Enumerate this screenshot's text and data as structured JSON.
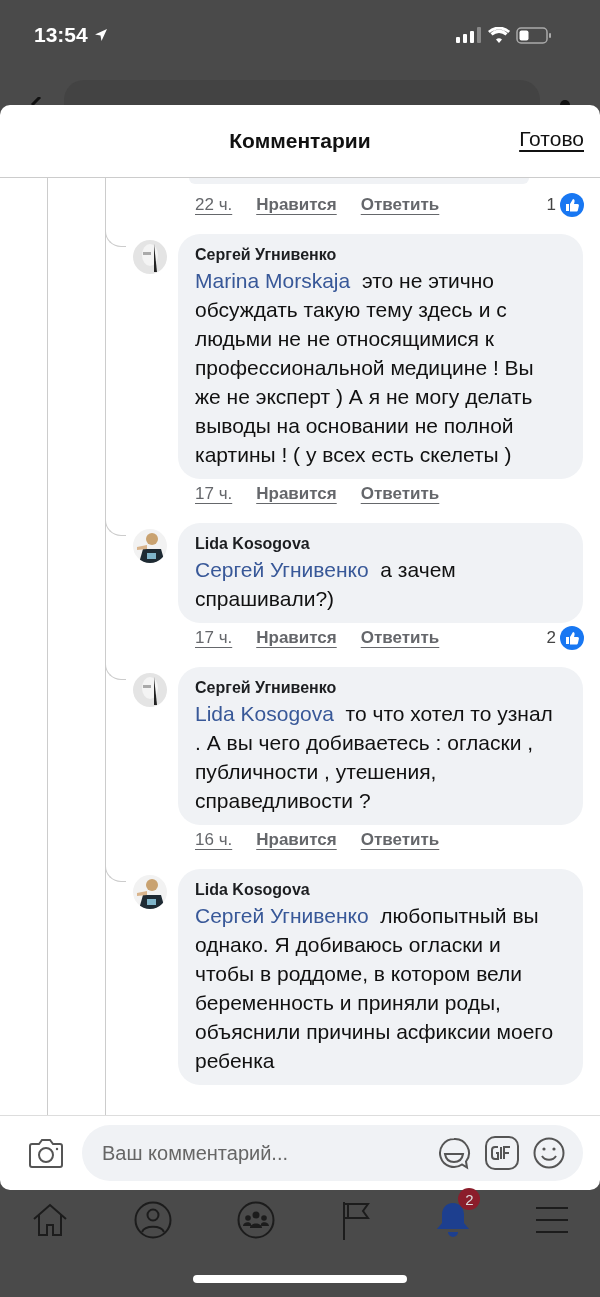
{
  "status_bar": {
    "time": "13:54"
  },
  "header": {
    "title": "Комментарии",
    "done": "Готово"
  },
  "top_actions": {
    "time": "22 ч.",
    "like": "Нравится",
    "reply": "Ответить",
    "reactions": "1"
  },
  "comments": [
    {
      "author": "Сергей Угнивенко",
      "mention": "Marina Morskaja",
      "text": "это не этично обсуждать такую тему здесь и с людьми не не относящимися к профессиональной медицине ! Вы же не эксперт ) А я не могу делать выводы на основании не полной картины ! ( у всех есть скелеты )",
      "time": "17 ч.",
      "like": "Нравится",
      "reply": "Ответить"
    },
    {
      "author": "Lida Kosogova",
      "mention": "Сергей Угнивенко",
      "text": "а зачем спрашивали?)",
      "time": "17 ч.",
      "like": "Нравится",
      "reply": "Ответить",
      "reactions": "2"
    },
    {
      "author": "Сергей Угнивенко",
      "mention": "Lida Kosogova",
      "text": "то что хотел то узнал . А вы чего добиваетесь : огласки , публичности , утешения, справедливости ?",
      "time": "16 ч.",
      "like": "Нравится",
      "reply": "Ответить"
    },
    {
      "author": "Lida Kosogova",
      "mention": "Сергей Угнивенко",
      "text": "любопытный вы однако. Я добиваюсь огласки и чтобы в роддоме, в котором вели беременность и приняли роды, объяснили причины асфиксии моего ребенка"
    }
  ],
  "composer": {
    "placeholder": "Ваш комментарий..."
  },
  "nav": [
    {
      "kind": "home",
      "selected": false
    },
    {
      "kind": "profile",
      "selected": false
    },
    {
      "kind": "groups",
      "selected": false
    },
    {
      "kind": "pages",
      "selected": false
    },
    {
      "kind": "notifications",
      "selected": true,
      "badge": "2"
    },
    {
      "kind": "menu",
      "selected": false
    }
  ]
}
